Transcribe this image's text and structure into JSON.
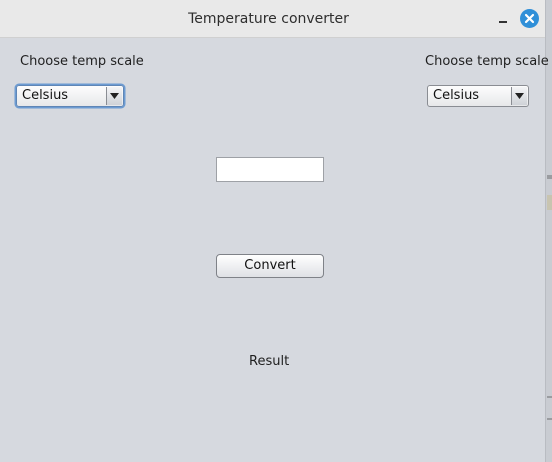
{
  "window": {
    "title": "Temperature converter"
  },
  "left_panel": {
    "label": "Choose temp scale",
    "selected": "Celsius"
  },
  "right_panel": {
    "label": "Choose temp scale",
    "selected": "Celsius"
  },
  "input": {
    "value": ""
  },
  "convert_button": {
    "label": "Convert"
  },
  "result": {
    "text": "Result"
  },
  "colors": {
    "close_button": "#2f8fd8",
    "background": "#d6d9df"
  }
}
